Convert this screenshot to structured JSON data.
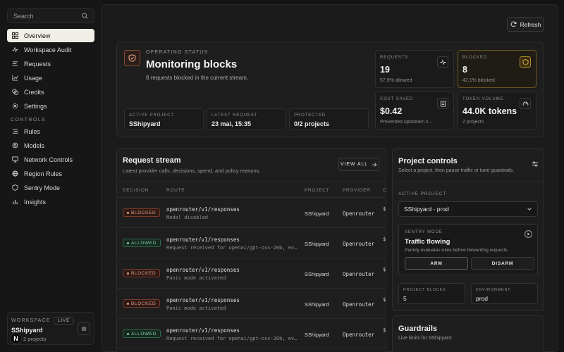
{
  "sidebar": {
    "search_placeholder": "Search",
    "items": [
      {
        "label": "Overview",
        "icon": "grid-icon"
      },
      {
        "label": "Workspace Audit",
        "icon": "activity-icon"
      },
      {
        "label": "Requests",
        "icon": "list-icon"
      },
      {
        "label": "Usage",
        "icon": "chart-icon"
      },
      {
        "label": "Credits",
        "icon": "coins-icon"
      },
      {
        "label": "Settings",
        "icon": "gear-icon"
      }
    ],
    "controls_label": "CONTROLS",
    "controls": [
      {
        "label": "Rules",
        "icon": "rules-icon"
      },
      {
        "label": "Models",
        "icon": "layers-icon"
      },
      {
        "label": "Network Controls",
        "icon": "monitor-icon"
      },
      {
        "label": "Region Rules",
        "icon": "globe-icon"
      },
      {
        "label": "Sentry Mode",
        "icon": "shield-icon"
      },
      {
        "label": "Insights",
        "icon": "bar-chart-icon"
      }
    ],
    "workspace": {
      "label": "WORKSPACE",
      "badge": "LIVE",
      "name": "SShipyard",
      "sub": "2 projects",
      "logo": "N"
    }
  },
  "header": {
    "refresh_label": "Refresh"
  },
  "status": {
    "kicker": "OPERATING STATUS",
    "title": "Monitoring blocks",
    "subtitle": "8 requests blocked in the current stream.",
    "minis": [
      {
        "label": "ACTIVE PROJECT",
        "value": "SShipyard"
      },
      {
        "label": "LATEST REQUEST",
        "value": "23 mai, 15:35"
      },
      {
        "label": "PROTECTED",
        "value": "0/2 projects"
      }
    ],
    "stats": [
      {
        "label": "REQUESTS",
        "value": "19",
        "sub": "57.9% allowed",
        "icon": "pulse-icon"
      },
      {
        "label": "BLOCKED",
        "value": "8",
        "sub": "42.1% blocked",
        "icon": "shield-icon"
      },
      {
        "label": "COST SAVED",
        "value": "$0.42",
        "sub": "Prevented upstream s...",
        "icon": "receipt-icon"
      },
      {
        "label": "TOKEN VOLUME",
        "value": "44.0K tokens",
        "sub": "2 projects",
        "icon": "gauge-icon"
      }
    ]
  },
  "stream": {
    "title": "Request stream",
    "subtitle": "Latest provider calls, decisions, spend, and policy reasons.",
    "view_all": "VIEW ALL",
    "columns": [
      "DECISION",
      "ROUTE",
      "PROJECT",
      "PROVIDER",
      "C"
    ],
    "rows": [
      {
        "decision": "BLOCKED",
        "route": "openrouter/v1/responses",
        "reason": "Model disabled",
        "project": "SShipyard",
        "provider": "Openrouter",
        "cost": "$"
      },
      {
        "decision": "ALLOWED",
        "route": "openrouter/v1/responses",
        "reason": "Request received for openai/gpt-oss-20b, ev…",
        "project": "SShipyard",
        "provider": "Openrouter",
        "cost": "$"
      },
      {
        "decision": "BLOCKED",
        "route": "openrouter/v1/responses",
        "reason": "Panic mode activated",
        "project": "SShipyard",
        "provider": "Openrouter",
        "cost": "$"
      },
      {
        "decision": "BLOCKED",
        "route": "openrouter/v1/responses",
        "reason": "Panic mode activated",
        "project": "SShipyard",
        "provider": "Openrouter",
        "cost": "$"
      },
      {
        "decision": "ALLOWED",
        "route": "openrouter/v1/responses",
        "reason": "Request received for openai/gpt-oss-20b, ev…",
        "project": "SShipyard",
        "provider": "Openrouter",
        "cost": "$"
      }
    ]
  },
  "controls": {
    "title": "Project controls",
    "subtitle": "Select a project, then pause traffic or tune guardrails.",
    "active_label": "ACTIVE PROJECT",
    "active_value": "SShipyard - prod",
    "sentry": {
      "label": "SENTRY MODE",
      "title": "Traffic flowing",
      "desc": "Panicly evaluates rules before forwarding requests.",
      "arm": "ARM",
      "disarm": "DISARM"
    },
    "project_blocks_label": "PROJECT BLOCKS",
    "project_blocks_value": "5",
    "environment_label": "ENVIRONMENT",
    "environment_value": "prod"
  },
  "guardrails": {
    "title": "Guardrails",
    "subtitle": "Live limits for SShipyard."
  },
  "colors": {
    "accent_bg": "#f1eee7",
    "blocked": "#e49a80",
    "allowed": "#7fd0a3",
    "warn": "#b08a2a"
  }
}
